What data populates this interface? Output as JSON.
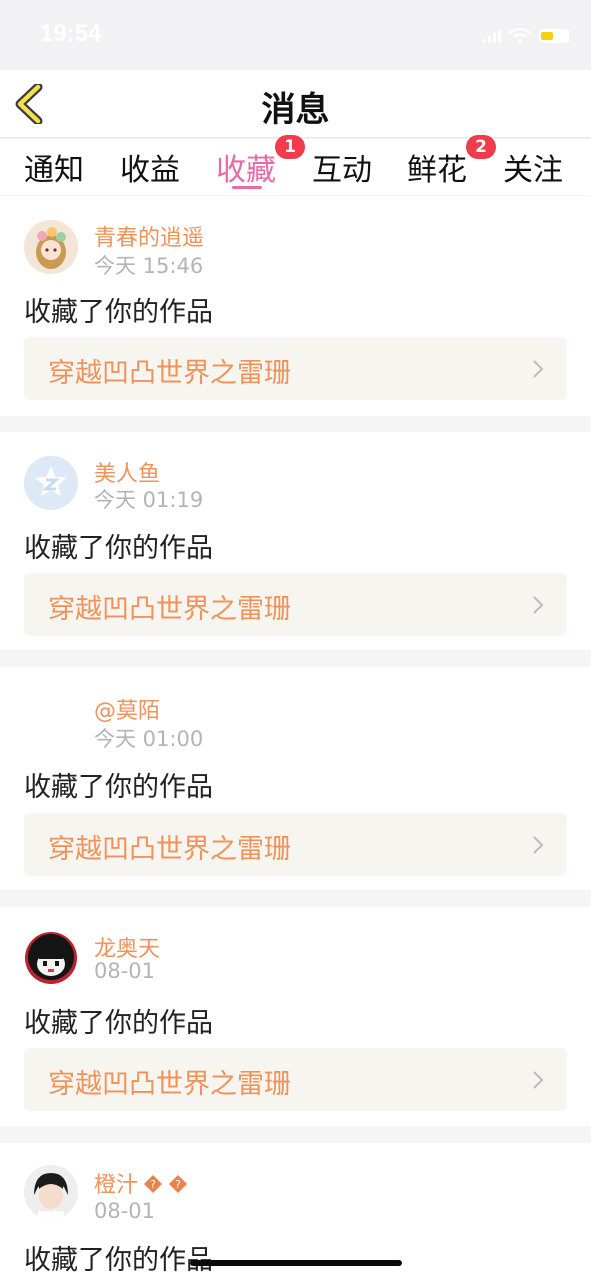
{
  "status_bar": {
    "time": "19:54"
  },
  "nav": {
    "title": "消息"
  },
  "tabs": [
    {
      "label": "通知"
    },
    {
      "label": "收益"
    },
    {
      "label": "收藏",
      "badge": "1",
      "active": true
    },
    {
      "label": "互动"
    },
    {
      "label": "鲜花",
      "badge": "2"
    },
    {
      "label": "关注"
    }
  ],
  "messages": [
    {
      "user": "青春的逍遥",
      "time": "今天 15:46",
      "action": "收藏了你的作品",
      "work": "穿越凹凸世界之雷珊"
    },
    {
      "user": "美人鱼",
      "time": "今天 01:19",
      "action": "收藏了你的作品",
      "work": "穿越凹凸世界之雷珊"
    },
    {
      "user": "@莫陌",
      "time": "今天 01:00",
      "action": "收藏了你的作品",
      "work": "穿越凹凸世界之雷珊"
    },
    {
      "user": "龙奥天",
      "time": "08-01",
      "action": "收藏了你的作品",
      "work": "穿越凹凸世界之雷珊"
    },
    {
      "user": "橙汁",
      "time": "08-01",
      "action": "收藏了你的作品"
    }
  ],
  "colors": {
    "accent_pink": "#e86aa6",
    "name_orange": "#f0935a",
    "badge_red": "#f03c4c"
  }
}
